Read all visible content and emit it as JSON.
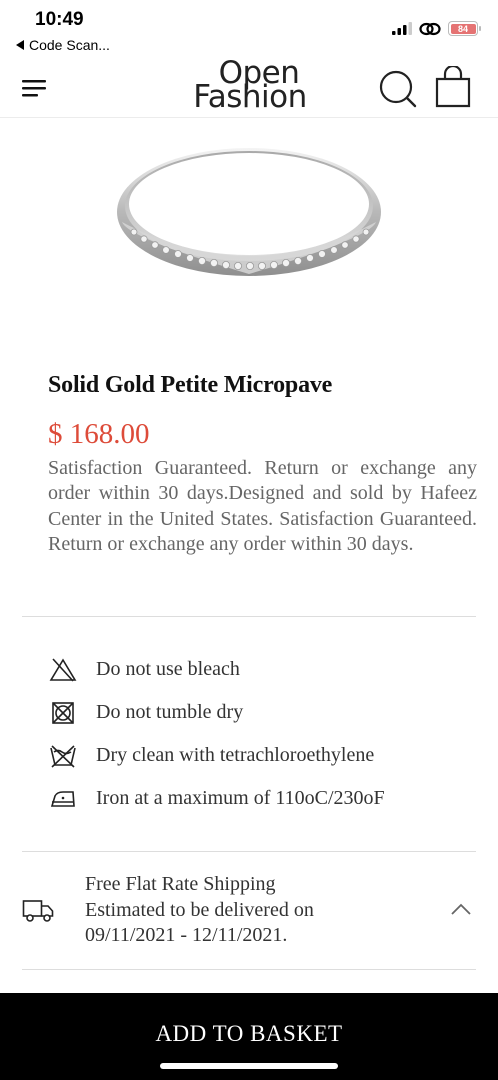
{
  "status_bar": {
    "time": "10:49",
    "back_app": "Code Scan...",
    "battery": "84"
  },
  "header": {
    "logo_line1": "Open",
    "logo_line2": "Fashion"
  },
  "product": {
    "title": "Solid Gold Petite Micropave",
    "price": "$ 168.00",
    "description": "Satisfaction Guaranteed. Return or exchange any order within 30 days.Designed and sold by Hafeez Center in the United States. Satisfaction Guaranteed. Return or exchange any order within 30 days."
  },
  "care": [
    {
      "icon": "no-bleach-icon",
      "label": "Do not use bleach"
    },
    {
      "icon": "no-tumble-dry-icon",
      "label": "Do not tumble dry"
    },
    {
      "icon": "dry-clean-icon",
      "label": "Dry clean with tetrachloroethylene"
    },
    {
      "icon": "iron-icon",
      "label": "Iron at a maximum of 110oC/230oF"
    }
  ],
  "shipping": {
    "title": "Free Flat Rate Shipping",
    "line2": "Estimated to be delivered on",
    "line3": "09/11/2021 - 12/11/2021."
  },
  "actions": {
    "add_to_basket": "ADD TO BASKET"
  },
  "colors": {
    "price": "#dd4b39",
    "button_bg": "#000000",
    "text": "#333333"
  }
}
